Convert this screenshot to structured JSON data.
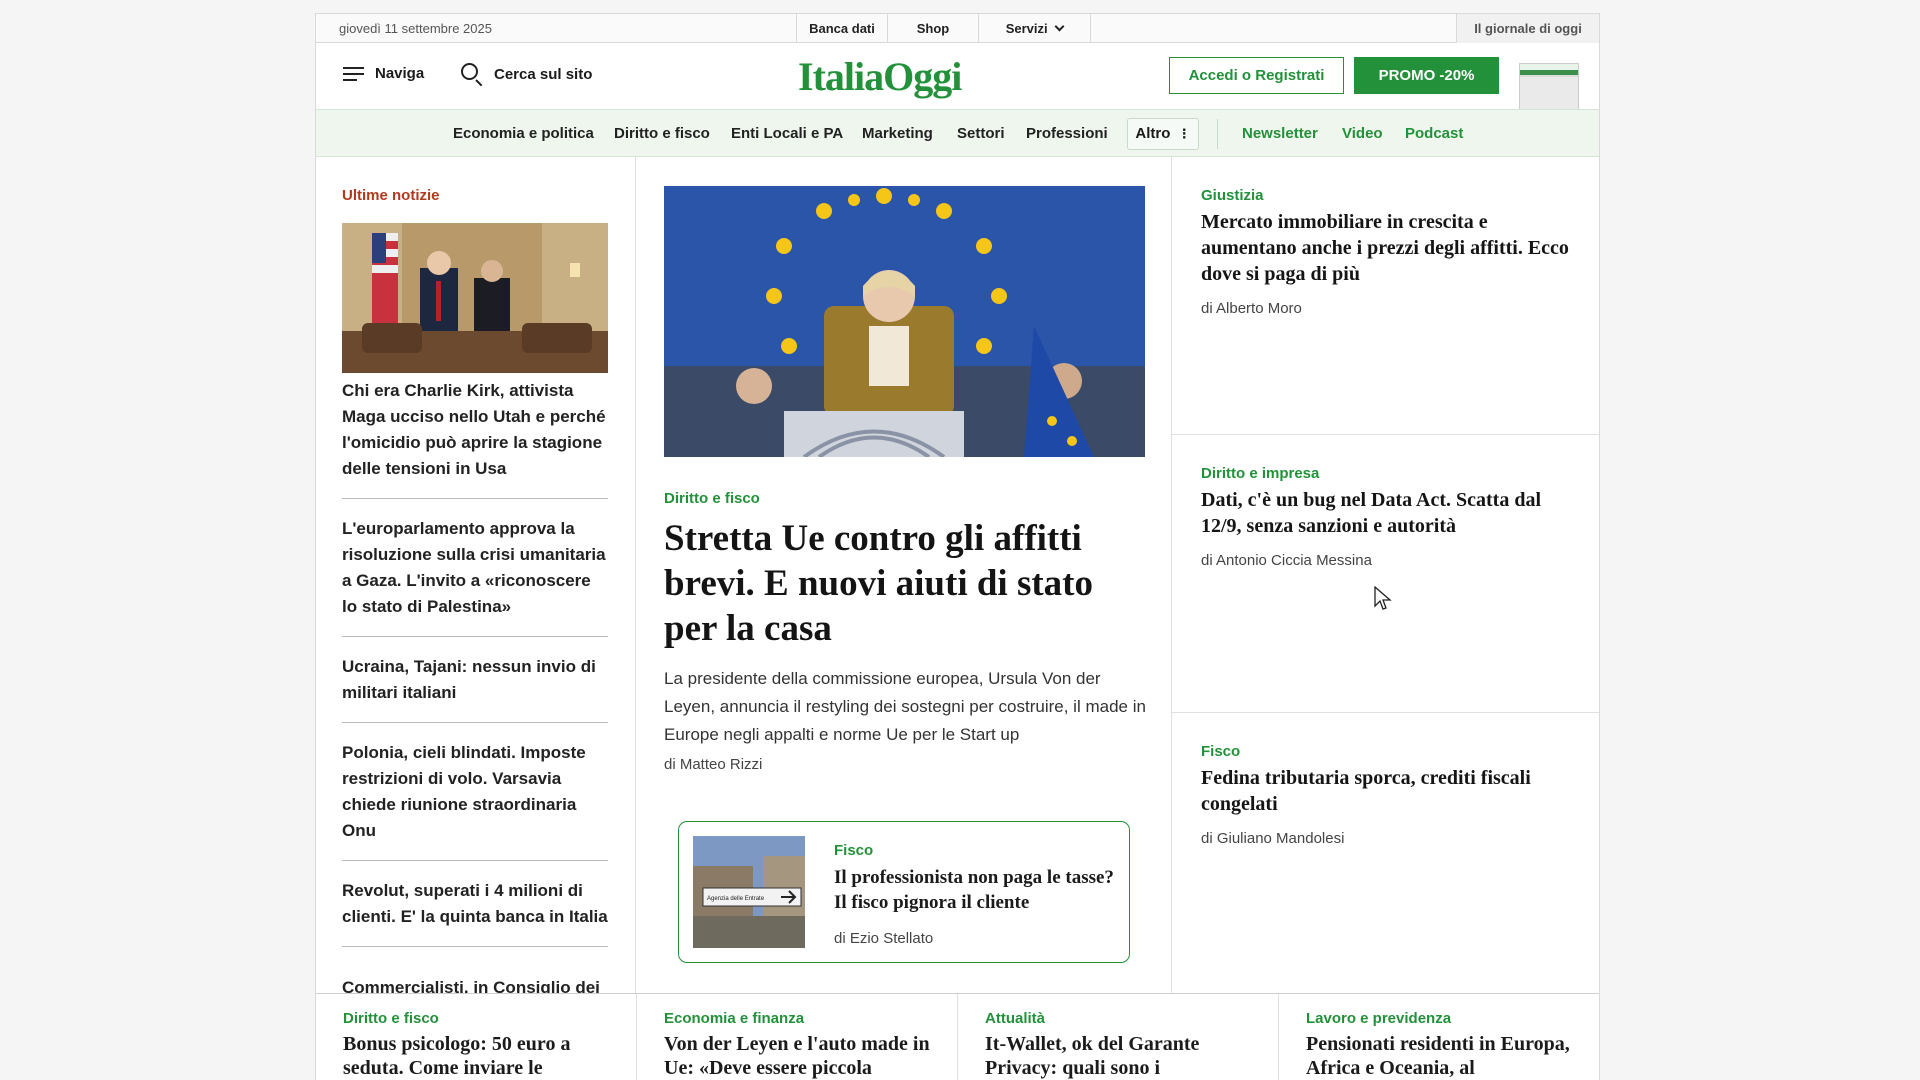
{
  "utilbar": {
    "date": "giovedì 11 settembre 2025",
    "banca_dati": "Banca dati",
    "shop": "Shop",
    "servizi": "Servizi",
    "giornale": "Il giornale di oggi"
  },
  "header": {
    "naviga": "Naviga",
    "search": "Cerca sul sito",
    "logo": "ItaliaOggi",
    "login": "Accedi o Registrati",
    "promo": "PROMO -20%"
  },
  "nav": {
    "items": [
      "Economia e politica",
      "Diritto e fisco",
      "Enti Locali e PA",
      "Marketing",
      "Settori",
      "Professioni"
    ],
    "altro": "Altro",
    "extra": [
      "Newsletter",
      "Video",
      "Podcast"
    ]
  },
  "left": {
    "heading": "Ultime notizie",
    "news": [
      "Chi era Charlie Kirk, attivista Maga ucciso nello Utah e perché l'omicidio può aprire la stagione delle tensioni in Usa",
      "L'europarlamento approva la risoluzione sulla crisi umanitaria a Gaza. L'invito a «riconoscere lo stato di Palestina»",
      "Ucraina, Tajani: nessun invio di militari italiani",
      "Polonia, cieli blindati. Imposte restrizioni di volo. Varsavia chiede riunione straordinaria Onu",
      "Revolut, superati i 4 milioni di clienti. E' la quinta banca in Italia",
      "Commercialisti, in Consiglio dei ministri una riforma modificata"
    ]
  },
  "hero": {
    "category": "Diritto e fisco",
    "title": "Stretta Ue contro gli affitti brevi. E nuovi aiuti di stato per la casa",
    "abstract": "La presidente della commissione europea, Ursula Von der Leyen, annuncia il restyling dei sostegni per costruire, il made in Europe negli appalti e norme Ue per le Start up",
    "author": "di Matteo Rizzi"
  },
  "card": {
    "category": "Fisco",
    "title": "Il professionista non paga le tasse? Il fisco pignora il cliente",
    "author": "di Ezio Stellato",
    "sign_text": "Agenzia delle Entrate"
  },
  "right": [
    {
      "category": "Giustizia",
      "title": "Mercato immobiliare in crescita e aumentano anche i prezzi degli affitti. Ecco dove si paga di più",
      "author": "di Alberto Moro"
    },
    {
      "category": "Diritto e impresa",
      "title": "Dati, c'è un bug nel Data Act. Scatta dal 12/9, senza sanzioni e autorità",
      "author": "di Antonio Ciccia Messina"
    },
    {
      "category": "Fisco",
      "title": "Fedina tributaria sporca, crediti fiscali congelati",
      "author": "di Giuliano Mandolesi"
    }
  ],
  "bottom": [
    {
      "category": "Diritto e fisco",
      "title": "Bonus psicologo: 50 euro a seduta. Come inviare le"
    },
    {
      "category": "Economia e finanza",
      "title": "Von der Leyen e l'auto made in Ue: «Deve essere piccola"
    },
    {
      "category": "Attualità",
      "title": "It-Wallet, ok del Garante Privacy: quali sono i"
    },
    {
      "category": "Lavoro e previdenza",
      "title": "Pensionati residenti in Europa, Africa e Oceania, al"
    }
  ]
}
